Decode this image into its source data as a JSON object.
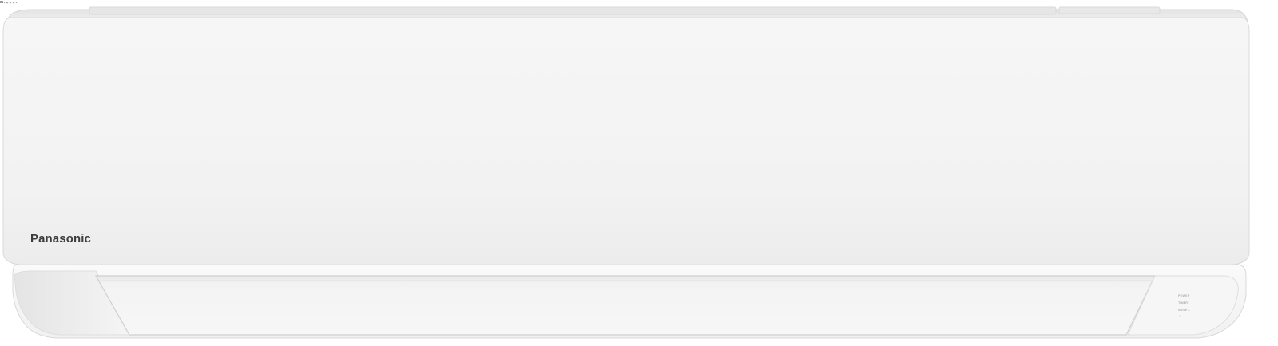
{
  "product": {
    "brand": "Panasonic",
    "indicators": [
      {
        "label": "POWER"
      },
      {
        "label": "TIMER"
      },
      {
        "label": "nanoe X"
      }
    ],
    "indicator_mark": "⌔",
    "sublogo_icon": "nanoe-logo-icon"
  },
  "colors": {
    "body": "#f4f4f4",
    "body_edge": "#e2e2e2",
    "panel": "#f7f7f7",
    "vane": "#f0f0f0",
    "brand_text": "#3c3c3c"
  }
}
